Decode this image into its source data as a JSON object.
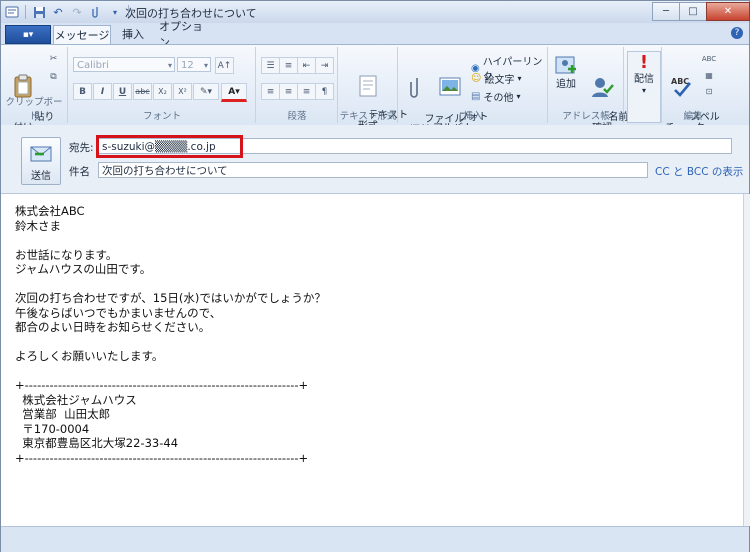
{
  "window": {
    "title": "次回の打ち合わせについて",
    "controls": {
      "minimize": "─",
      "maximize": "□",
      "close": "✕"
    }
  },
  "ribbon": {
    "file_button": "▪▾",
    "tabs": [
      "メッセージ",
      "挿入",
      "オプション"
    ],
    "help": "?",
    "groups": {
      "clipboard": {
        "label": "クリップボード",
        "paste": "貼り\n付け"
      },
      "font": {
        "label": "フォント",
        "font_name": "Calibri",
        "font_size": "12",
        "bold": "B",
        "italic": "I",
        "underline": "U",
        "strike": "abc",
        "sub": "X₂",
        "sup": "X²"
      },
      "paragraph": {
        "label": "段落"
      },
      "textformat": {
        "label": "テキスト形式",
        "button": "テキスト\n形式"
      },
      "insert": {
        "label": "挿入",
        "attach": "ファイル\nの添付",
        "photo": "フォト\nアルバム",
        "hyperlink": "ハイパーリンク",
        "emoji": "絵文字",
        "other": "その他"
      },
      "addressbook": {
        "label": "アドレス帳",
        "add": "追加",
        "check_names": "名前の\n確認"
      },
      "delivery": {
        "label": "",
        "priority": "配信"
      },
      "edit": {
        "label": "編集",
        "spell": "スペル\nチェック"
      }
    }
  },
  "header": {
    "send": "送信",
    "to_label": "宛先:",
    "to_value": "s-suzuki@▒▒▒▒.co.jp",
    "subject_label": "件名",
    "subject_value": "次回の打ち合わせについて",
    "cc_bcc": "CC と BCC の表示"
  },
  "body": {
    "text": "株式会社ABC\n鈴木さま\n\nお世話になります。\nジャムハウスの山田です。\n\n次回の打ち合わせですが、15日(水)ではいかがでしょうか？\n午後ならばいつでもかまいませんので、\n都合のよい日時をお知らせください。\n\nよろしくお願いいたします。\n\n+------------------------------------------------------------------+\n  株式会社ジャムハウス\n  営業部  山田太郎\n  〒170-0004\n  東京都豊島区北大塚22-33-44\n+------------------------------------------------------------------+"
  },
  "colors": {
    "highlight_box": "#d4141a",
    "link": "#2c62b6"
  }
}
